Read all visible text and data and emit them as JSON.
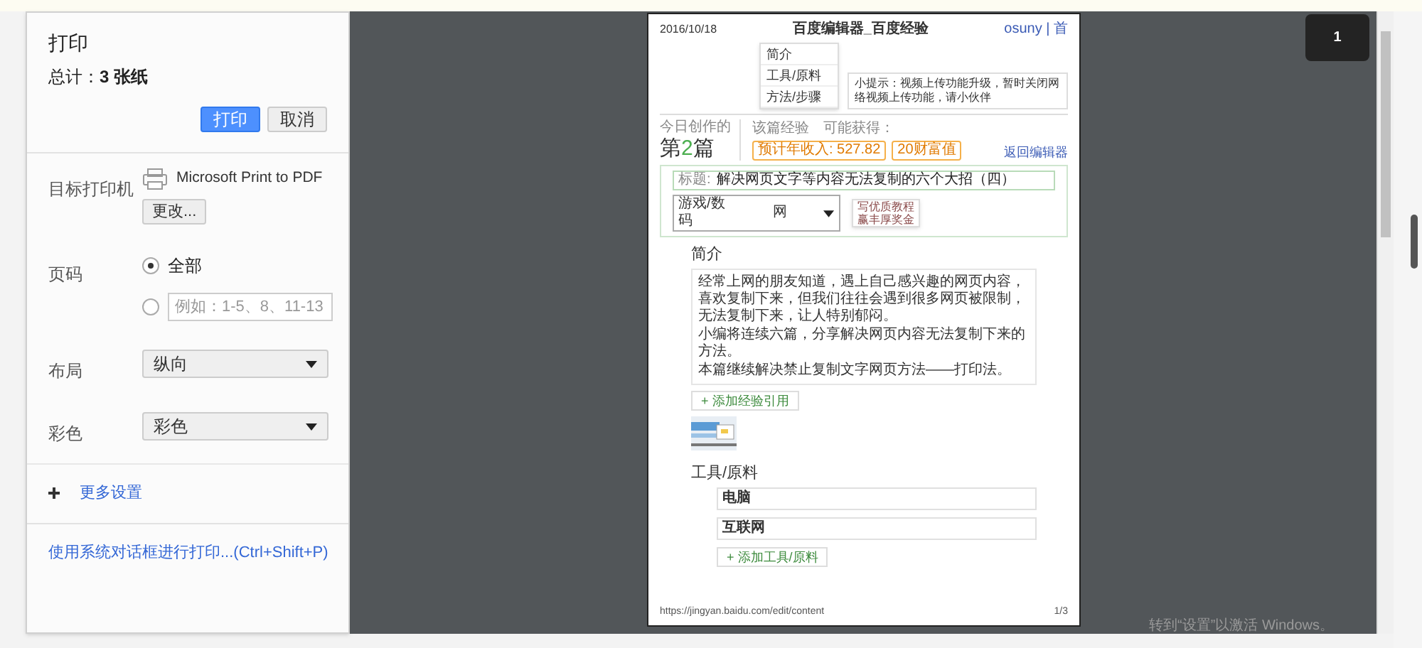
{
  "dialog": {
    "title": "打印",
    "total": "总计：**3 张纸**",
    "print_button": "打印",
    "cancel_button": "取消"
  },
  "settings": [
    {
      "kind": "printer",
      "label": "目标打印机",
      "printer": "Microsoft Print to PDF",
      "button": "更改..."
    },
    {
      "kind": "pages",
      "label": "页码",
      "options": [
        {
          "label": "全部",
          "selected": true
        },
        {
          "placeholder": "例如：1-5、8、11-13",
          "selected": false
        }
      ]
    },
    {
      "kind": "select",
      "label": "布局",
      "value": "纵向"
    },
    {
      "kind": "select",
      "label": "彩色",
      "value": "彩色"
    }
  ],
  "more_settings": "更多设置",
  "system_dialog_link": "使用系统对话框进行打印...(Ctrl+Shift+P)",
  "preview": {
    "date": "2016/10/18",
    "doc_title": "百度编辑器_百度经验",
    "user_links": "osuny | 首",
    "nav_menu": [
      "简介",
      "工具/原料",
      "方法/步骤"
    ],
    "tip": "小提示：视频上传功能升级，暂时关闭网络视频上传功能，请小伙伴",
    "today_label": "今日创作的",
    "today_prefix": "第",
    "today_number": "2",
    "today_suffix": "篇",
    "earn_label": "该篇经验",
    "earn_label_2": "可能获得：",
    "income": "预计年收入: 527.82",
    "wealth": "20财富值",
    "editor_link": "返回编辑器",
    "title_label": "标题:",
    "title_value": "解决网页文字等内容无法复制的六个大招（四）",
    "category": "游戏/数码",
    "category_2": "网",
    "promo": [
      "写优质教程",
      "赢丰厚奖金"
    ],
    "intro_heading": "简介",
    "intro_paragraphs": [
      "经常上网的朋友知道，遇上自己感兴趣的网页内容，喜欢复制下来，但我们往往会遇到很多网页被限制，无法复制下来，让人特别郁闷。",
      "小编将连续六篇，分享解决网页内容无法复制下来的方法。",
      "本篇继续解决禁止复制文字网页方法——打印法。"
    ],
    "add_reference": "+ 添加经验引用",
    "tools_heading": "工具/原料",
    "tools": [
      "电脑",
      "互联网"
    ],
    "add_tool": "+ 添加工具/原料",
    "footer_url": "https://jingyan.baidu.com/edit/content",
    "footer_page": "1/3"
  },
  "page_badge": "1",
  "activation_notice": "转到“设置”以激活 Windows。"
}
